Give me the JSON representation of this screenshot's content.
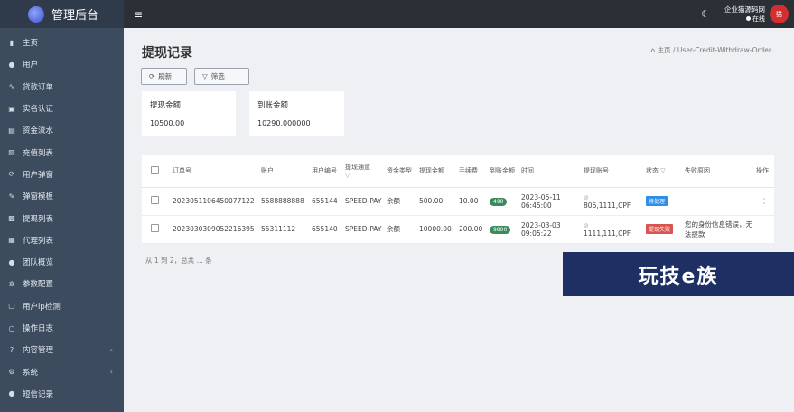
{
  "brand": {
    "title": "管理后台"
  },
  "sidebar": {
    "items": [
      {
        "label": "主页",
        "icon": "▮"
      },
      {
        "label": "用户",
        "icon": "●"
      },
      {
        "label": "贷款订单",
        "icon": "∿"
      },
      {
        "label": "实名认证",
        "icon": "▣"
      },
      {
        "label": "资金流水",
        "icon": "▤"
      },
      {
        "label": "充值列表",
        "icon": "▧"
      },
      {
        "label": "用户弹窗",
        "icon": "⟳"
      },
      {
        "label": "弹窗模板",
        "icon": "✎"
      },
      {
        "label": "提现列表",
        "icon": "▩"
      },
      {
        "label": "代理列表",
        "icon": "▦"
      },
      {
        "label": "团队概览",
        "icon": "●"
      },
      {
        "label": "参数配置",
        "icon": "✲"
      },
      {
        "label": "用户ip检测",
        "icon": "▢"
      },
      {
        "label": "操作日志",
        "icon": "○"
      },
      {
        "label": "内容管理",
        "icon": "?",
        "chevron": "‹"
      },
      {
        "label": "系统",
        "icon": "⚙",
        "chevron": "‹"
      },
      {
        "label": "短信记录",
        "icon": "●"
      }
    ]
  },
  "topbar": {
    "menu_icon": "≡",
    "moon_icon": "☾",
    "user_name": "企业猫源码网",
    "user_status": "在线",
    "avatar_text": "猫"
  },
  "page": {
    "title": "提现记录",
    "breadcrumb_home": "主页",
    "breadcrumb_sep": "/",
    "breadcrumb_current": "User-Credit-Withdraw-Order",
    "refresh_label": "刷新",
    "filter_label": "筛选"
  },
  "stats": [
    {
      "label": "提现金额",
      "value": "10500.00"
    },
    {
      "label": "到账金额",
      "value": "10290.000000"
    }
  ],
  "table": {
    "headers": [
      "订单号",
      "账户",
      "用户编号",
      "提现通道",
      "资金类型",
      "提现金额",
      "手续费",
      "到账金额",
      "时间",
      "提现账号",
      "状态",
      "失败原因",
      "操作"
    ],
    "rows": [
      {
        "order_no": "2023051106450077122",
        "account": "5588888888",
        "user_no": "655144",
        "channel": "SPEED-PAY",
        "fund_type": "余额",
        "amount": "500.00",
        "fee": "10.00",
        "received": "490",
        "time": "2023-05-11 06:45:00",
        "withdraw_account": "806,1111,CPF",
        "status": "待处理",
        "status_color": "#2f8ee6",
        "reason": ""
      },
      {
        "order_no": "2023030309052216395",
        "account": "55311112",
        "user_no": "655140",
        "channel": "SPEED-PAY",
        "fund_type": "余额",
        "amount": "10000.00",
        "fee": "200.00",
        "received": "9800",
        "time": "2023-03-03 09:05:22",
        "withdraw_account": "1111,111,CPF",
        "status": "提现失败",
        "status_color": "#d9534f",
        "reason": "您的身份信息错误，无法提款"
      }
    ]
  },
  "pager": {
    "text": "从 1 到 2，总共 ... 条"
  },
  "watermark": {
    "text": "玩技e族"
  }
}
